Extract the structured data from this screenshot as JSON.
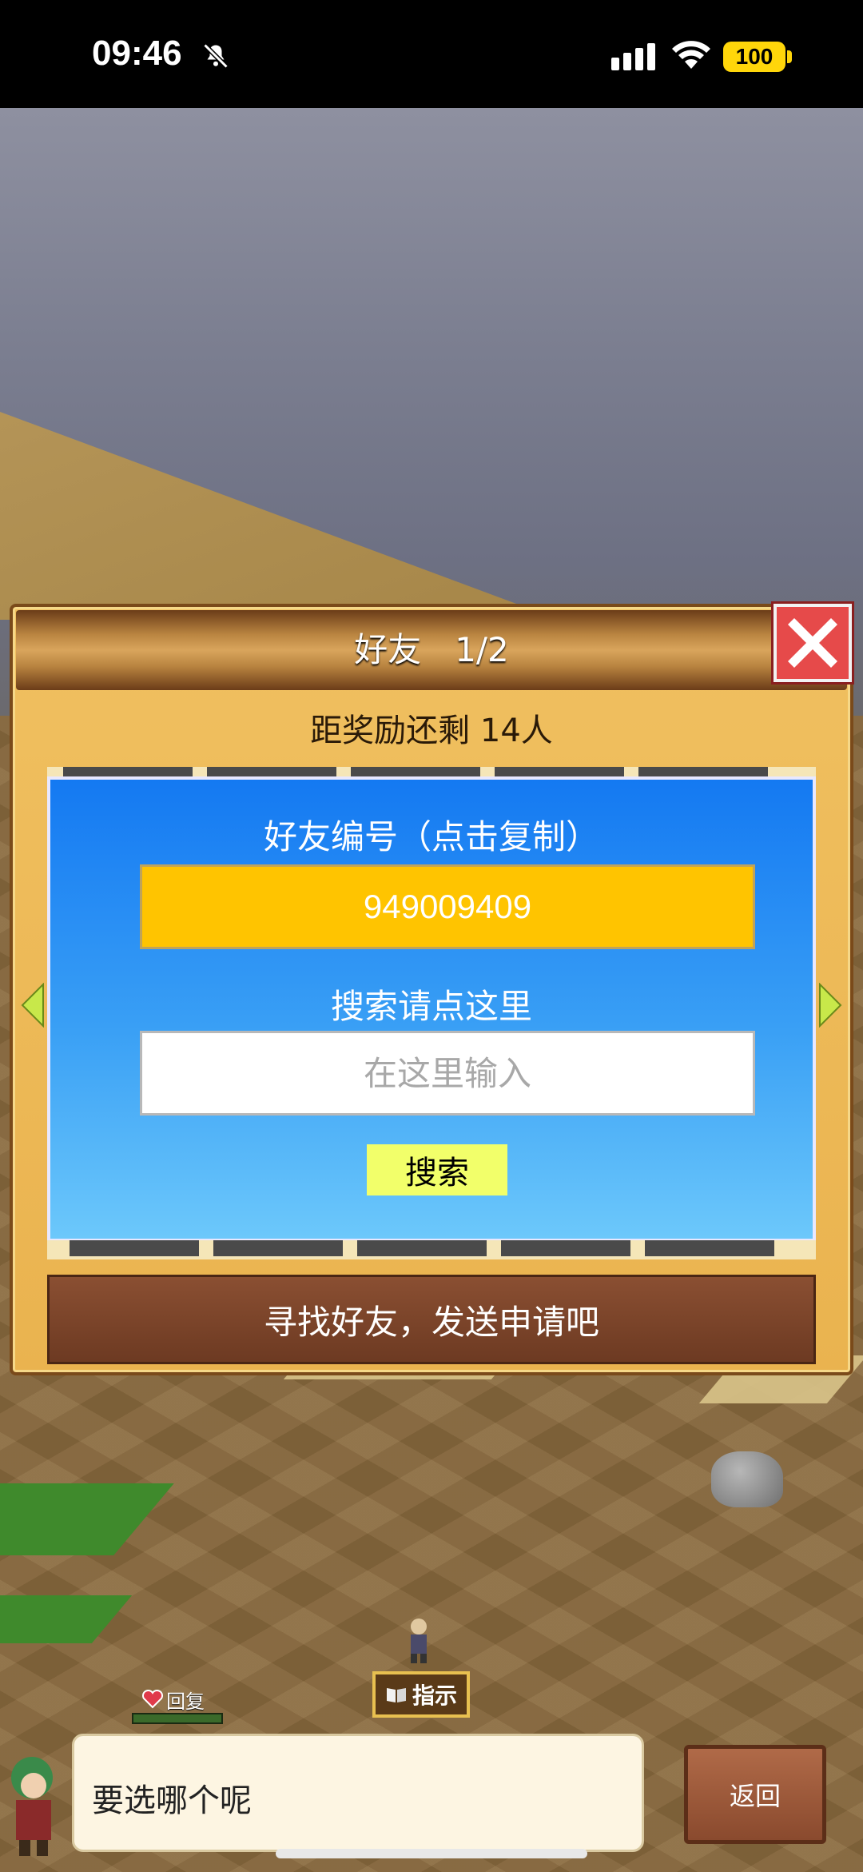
{
  "status_bar": {
    "time": "09:46",
    "battery": "100",
    "icons": [
      "bell-slash-icon",
      "signal-icon",
      "wifi-icon",
      "battery-icon"
    ]
  },
  "dialog": {
    "title": "好友　1/2",
    "reward_text": "距奖励还剩 14人",
    "friend_id_label": "好友编号（点击复制）",
    "friend_id": "949009409",
    "search_label": "搜索请点这里",
    "search_placeholder": "在这里输入",
    "search_button": "搜索",
    "banner": "寻找好友，发送申请吧"
  },
  "hud": {
    "recover_label": "回复",
    "hint_label": "指示",
    "message": "要选哪个呢",
    "back_label": "返回"
  },
  "colors": {
    "id_box": "#ffc400",
    "search_button": "#f2ff6a",
    "close_button": "#e64a4a",
    "battery": "#ffd60a"
  }
}
